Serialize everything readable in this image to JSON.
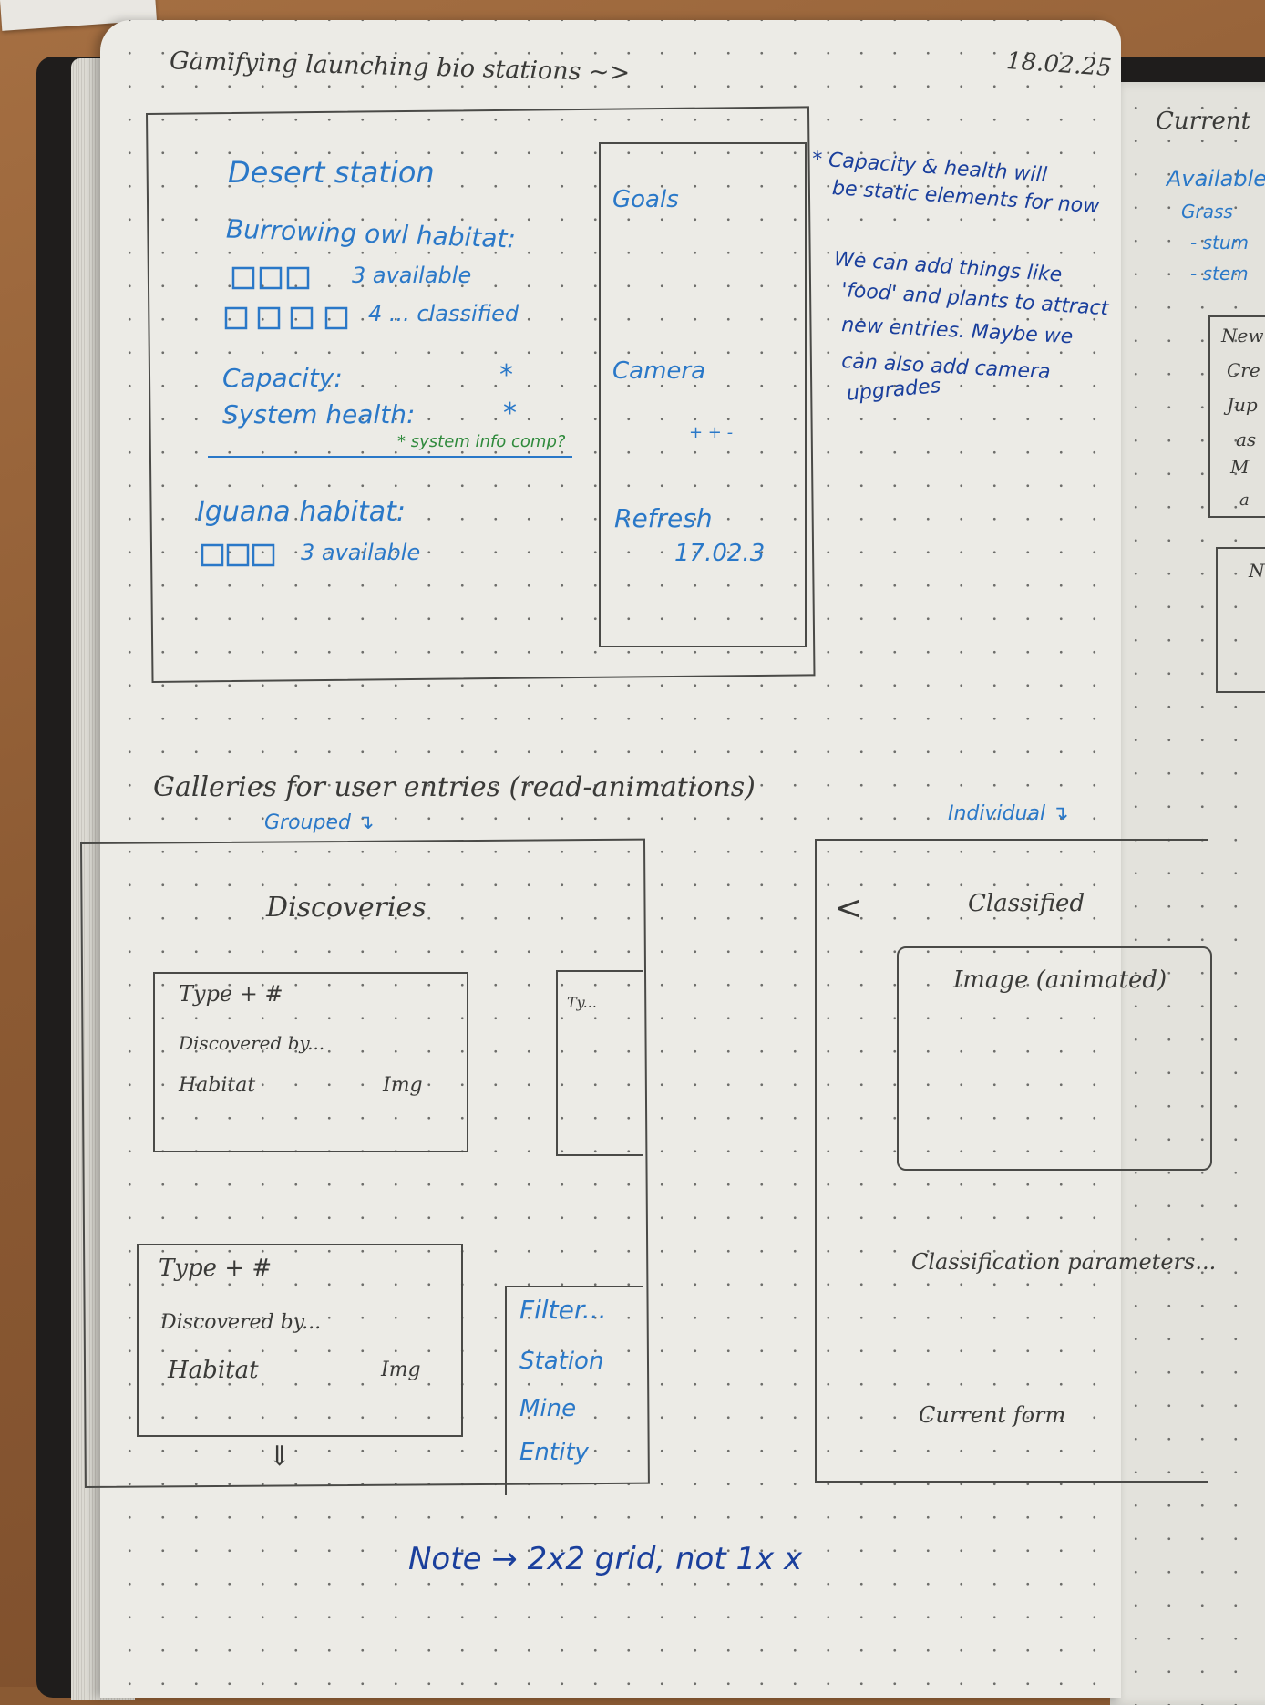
{
  "header": {
    "title": "Gamifying launching bio stations ~>",
    "date": "18.02.25"
  },
  "station_sketch": {
    "station_name": "Desert station",
    "habitat1": {
      "label": "Burrowing owl habitat:",
      "line1": "3 available",
      "line2": "4 ... classified"
    },
    "capacity_label": "Capacity:",
    "health_label": "System health:",
    "star1": "*",
    "star2": "*",
    "green_note": "* system info comp?",
    "habitat2": {
      "label": "Iguana habitat:",
      "line1": "3 available"
    },
    "side": {
      "goals_label": "Goals",
      "camera_label": "Camera",
      "camera_mark": "+ + -",
      "refresh_label": "Refresh",
      "refresh_value": "17.02.3"
    }
  },
  "notes": {
    "capacity_note_1": "* Capacity & health will",
    "capacity_note_2": "be static elements for now",
    "add_things_1": "We can add things like",
    "add_things_2": "'food' and plants to attract",
    "add_things_3": "new entries. Maybe we",
    "add_things_4": "can also add camera",
    "add_things_5": "upgrades"
  },
  "galleries": {
    "title": "Galleries for user entries (read-animations)",
    "grouped_label": "Grouped ↴",
    "individual_label": "Individual ↴",
    "grouped_panel": {
      "heading": "Discoveries",
      "card1": {
        "line1": "Type + #",
        "line2": "Discovered by...",
        "line3": "Habitat",
        "img": "Img"
      },
      "card2_partial": "Ty...",
      "card3": {
        "line1": "Type + #",
        "line2": "Discovered by...",
        "line3": "Habitat",
        "img": "Img"
      },
      "scroll_arrow": "⇓",
      "filter": {
        "title": "Filter...",
        "opt1": "Station",
        "opt2": "Mine",
        "opt3": "Entity"
      }
    },
    "individual_panel": {
      "back_arrow": "<",
      "heading": "Classified",
      "image_label": "Image (animated)",
      "params_label": "Classification parameters...",
      "form_label": "Current form"
    }
  },
  "footnote": "Note → 2x2 grid, not 1x x",
  "right_page": {
    "line1": "Current",
    "line2": "Available",
    "line3": "Grass",
    "line4": "- stum",
    "line5": "- stem",
    "box_lines": [
      "New",
      "Cre",
      "Jup",
      "as",
      "M",
      "a"
    ],
    "box2_line": "N"
  },
  "colors": {
    "pencil": "#3a3a38",
    "blue_ink": "#2a78c8",
    "green_ink": "#2f8a3c",
    "navy_ink": "#1a3f9c",
    "paper": "#ecebe6"
  }
}
